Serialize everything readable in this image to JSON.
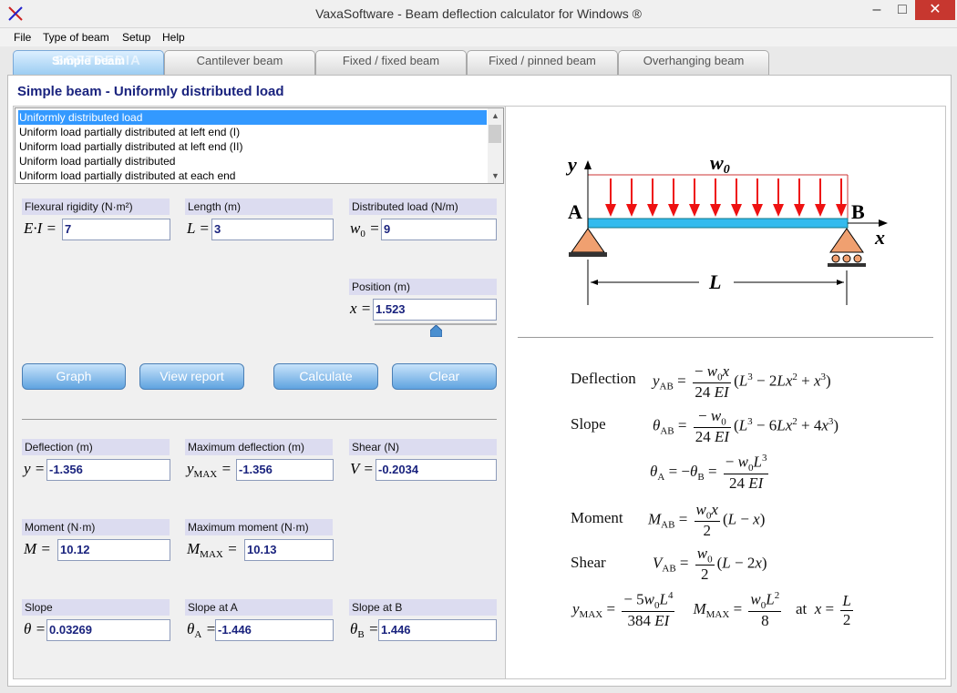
{
  "window": {
    "title": "VaxaSoftware - Beam deflection calculator for Windows ®"
  },
  "menu": [
    "File",
    "Type of beam",
    "Setup",
    "Help"
  ],
  "tabs": [
    "Simple beam",
    "Cantilever beam",
    "Fixed / fixed beam",
    "Fixed / pinned beam",
    "Overhanging beam"
  ],
  "heading": "Simple beam - Uniformly distributed load",
  "load_types": [
    "Uniformly distributed load",
    "Uniform load partially distributed at left end (I)",
    "Uniform load partially distributed at left end (II)",
    "Uniform load partially distributed",
    "Uniform load partially distributed at each end"
  ],
  "inputs": {
    "ei": {
      "label": "Flexural rigidity (N·m²)",
      "value": "7"
    },
    "length": {
      "label": "Length (m)",
      "value": "3"
    },
    "load": {
      "label": "Distributed load (N/m)",
      "value": "9"
    },
    "position": {
      "label": "Position (m)",
      "value": "1.523"
    }
  },
  "buttons": {
    "graph": "Graph",
    "report": "View report",
    "calculate": "Calculate",
    "clear": "Clear"
  },
  "results": {
    "deflection": {
      "label": "Deflection (m)",
      "value": "-1.356"
    },
    "max_deflection": {
      "label": "Maximum deflection (m)",
      "value": "-1.356"
    },
    "shear": {
      "label": "Shear (N)",
      "value": "-0.2034"
    },
    "moment": {
      "label": "Moment (N·m)",
      "value": "10.12"
    },
    "max_moment": {
      "label": "Maximum moment (N·m)",
      "value": "10.13"
    },
    "slope": {
      "label": "Slope",
      "value": "0.03269"
    },
    "slope_a": {
      "label": "Slope at A",
      "value": "-1.446"
    },
    "slope_b": {
      "label": "Slope at B",
      "value": "1.446"
    }
  },
  "formulas": {
    "deflection": "Deflection",
    "slope": "Slope",
    "moment": "Moment",
    "shear": "Shear",
    "at": "at"
  },
  "diagram": {
    "y": "y",
    "w0": "w",
    "A": "A",
    "B": "B",
    "x": "x",
    "L": "L"
  },
  "watermark": "SOFTPEDIA",
  "colors": {
    "load_arrows": "#ee1111",
    "beam": "#33bbee",
    "support": "#f0a070"
  }
}
